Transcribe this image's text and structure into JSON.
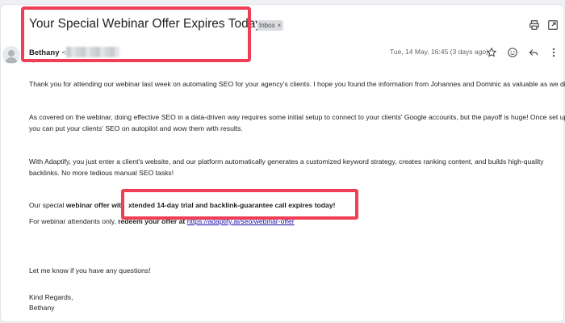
{
  "email": {
    "subject": "Your Special Webinar Offer Expires Today",
    "label": "Inbox",
    "label_close": "×",
    "sender_name": "Bethany",
    "sender_lt": "<",
    "date": "Tue, 14 May, 16:45 (3 days ago)"
  },
  "icons": {
    "print": "print-icon",
    "open_new": "open-in-new-window-icon",
    "star": "star-icon",
    "emoji": "emoji-icon",
    "reply": "reply-icon",
    "more": "more-vertical-icon",
    "avatar": "avatar-icon"
  },
  "body": {
    "p1": "Thank you for attending our webinar last week on automating SEO for your agency's clients. I hope you found the information from Johannes and Dominic as valuable as we did!",
    "p2_l1": "As covered on the webinar, doing effective SEO in a data-driven way requires some initial setup to connect to your clients' Google accounts, but the payoff is huge! Once set up,",
    "p2_l2": "you can put your clients' SEO on autopilot and wow them with results.",
    "p3_l1": "With Adaptify, you just enter a client's website, and our platform automatically generates a customized keyword strategy, creates ranking content, and builds high-quality",
    "p3_l2": "backlinks. No more tedious manual SEO tasks!",
    "offer_prefix": "Our special ",
    "offer_bold": "webinar offer with",
    "offer_highlight": "xtended 14-day trial and backlink-guarantee call expires today!",
    "attendees_prefix": "For webinar attendants only, ",
    "attendees_bold": "redeem your offer at",
    "attendees_link": "https://adaptify.ai/seo/webinar-offer",
    "questions": "Let me know if you have any questions!",
    "signoff": "Kind Regards,",
    "signature": "Bethany"
  },
  "colors": {
    "highlight_border": "#ef3e56",
    "link": "#1a0dab"
  }
}
